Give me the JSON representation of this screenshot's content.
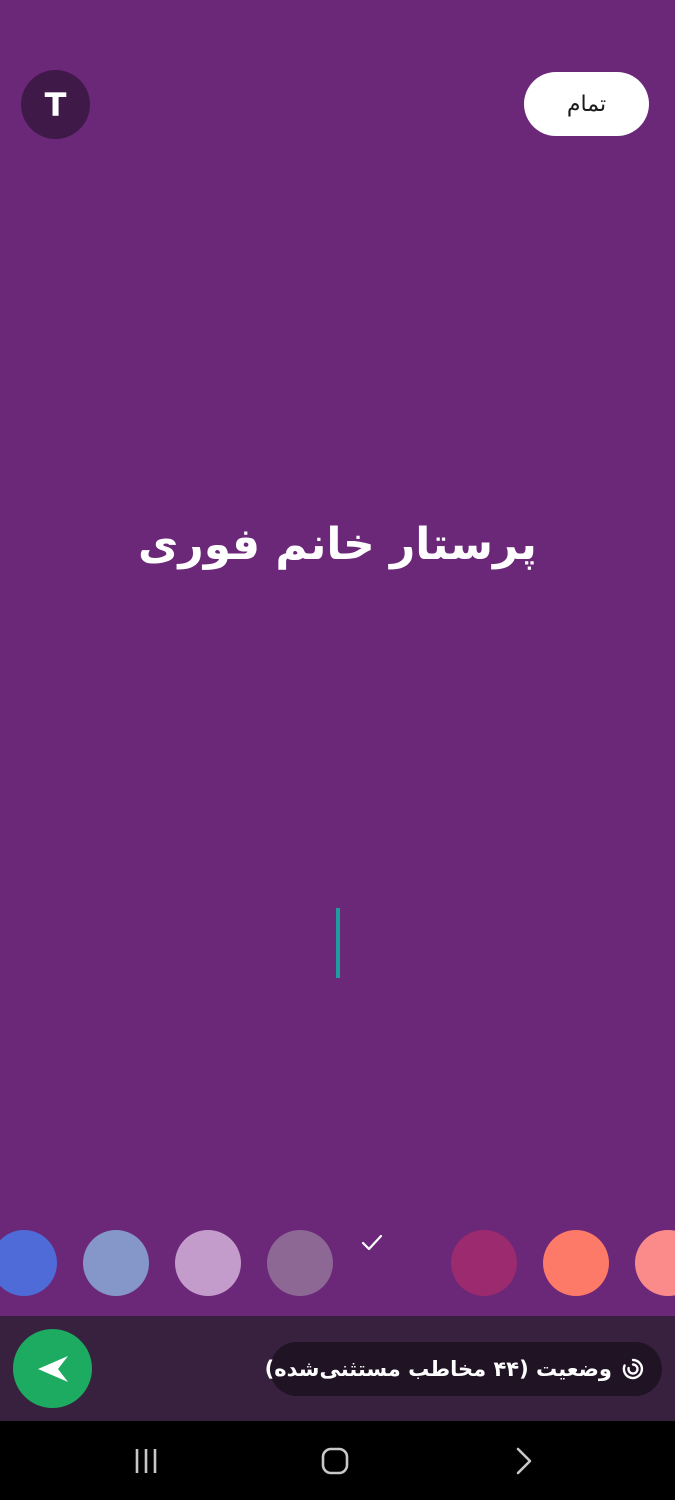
{
  "toolbar": {
    "font_toggle_label": "T",
    "done_label": "تمام"
  },
  "editor": {
    "status_text": "پرستار خانم فوری",
    "background_color": "#6b2778",
    "caret_color": "#1f9ba0"
  },
  "color_picker": {
    "swatches": [
      {
        "color": "#4f6bd8",
        "selected": false
      },
      {
        "color": "#8597c9",
        "selected": false
      },
      {
        "color": "#c49ccb",
        "selected": false
      },
      {
        "color": "#8d6894",
        "selected": false
      },
      {
        "color": "#6b2778",
        "selected": true
      },
      {
        "color": "#9b2a6e",
        "selected": false
      },
      {
        "color": "#fc7a67",
        "selected": false
      },
      {
        "color": "#fb8b8b",
        "selected": false
      }
    ]
  },
  "bottom_bar": {
    "audience_label": "وضعیت (۴۴ مخاطب مستثنی‌شده)",
    "audience_icon": "status-ring-icon",
    "send_icon": "send-arrow-icon",
    "send_color": "#1dab61"
  },
  "system_nav": {
    "buttons": [
      "recent-apps-icon",
      "home-icon",
      "back-icon"
    ]
  }
}
